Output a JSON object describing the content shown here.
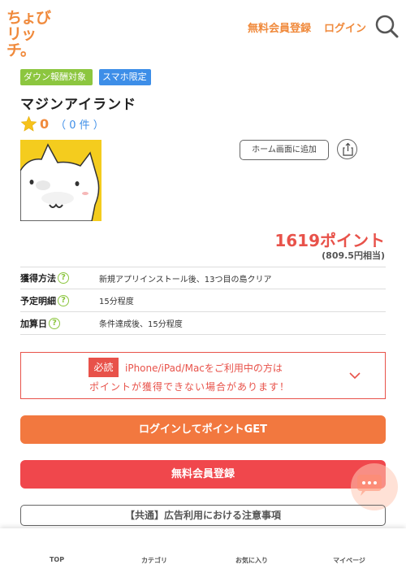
{
  "header": {
    "logo_line1": "ちょび",
    "logo_line2": "リッチ。",
    "register_link": "無料会員登録",
    "login_link": "ログイン",
    "search_icon": "search-icon"
  },
  "badges": [
    "ダウン報酬対象",
    "スマホ限定"
  ],
  "app": {
    "title": "マジンアイランド",
    "rating_score": "0",
    "rating_count": "（ 0 件 ）",
    "home_button": "ホーム画面に追加",
    "points": "1619ポイント",
    "points_yen": "(809.5円相当)"
  },
  "info": [
    {
      "label": "獲得方法",
      "value": "新規アプリインストール後、13つ目の島クリア"
    },
    {
      "label": "予定明細",
      "value": "15分程度"
    },
    {
      "label": "加算日",
      "value": "条件達成後、15分程度"
    }
  ],
  "notice": {
    "tag": "必読",
    "line1": "iPhone/iPad/Macをご利用中の方は",
    "line2": "ポイントが獲得できない場合があります！"
  },
  "buttons": {
    "login_get": "ログインしてポイントGET",
    "register": "無料会員登録",
    "common_notice": "【共通】広告利用における注意事項"
  },
  "nav": [
    "TOP",
    "カテゴリ",
    "お気に入り",
    "マイページ"
  ],
  "colors": {
    "brand_orange": "#f08a3c",
    "accent_red": "#e8524a",
    "badge_green": "#8cc63f",
    "badge_blue": "#3d8ee8",
    "login_button": "#f2783f",
    "register_button": "#f0474c"
  }
}
